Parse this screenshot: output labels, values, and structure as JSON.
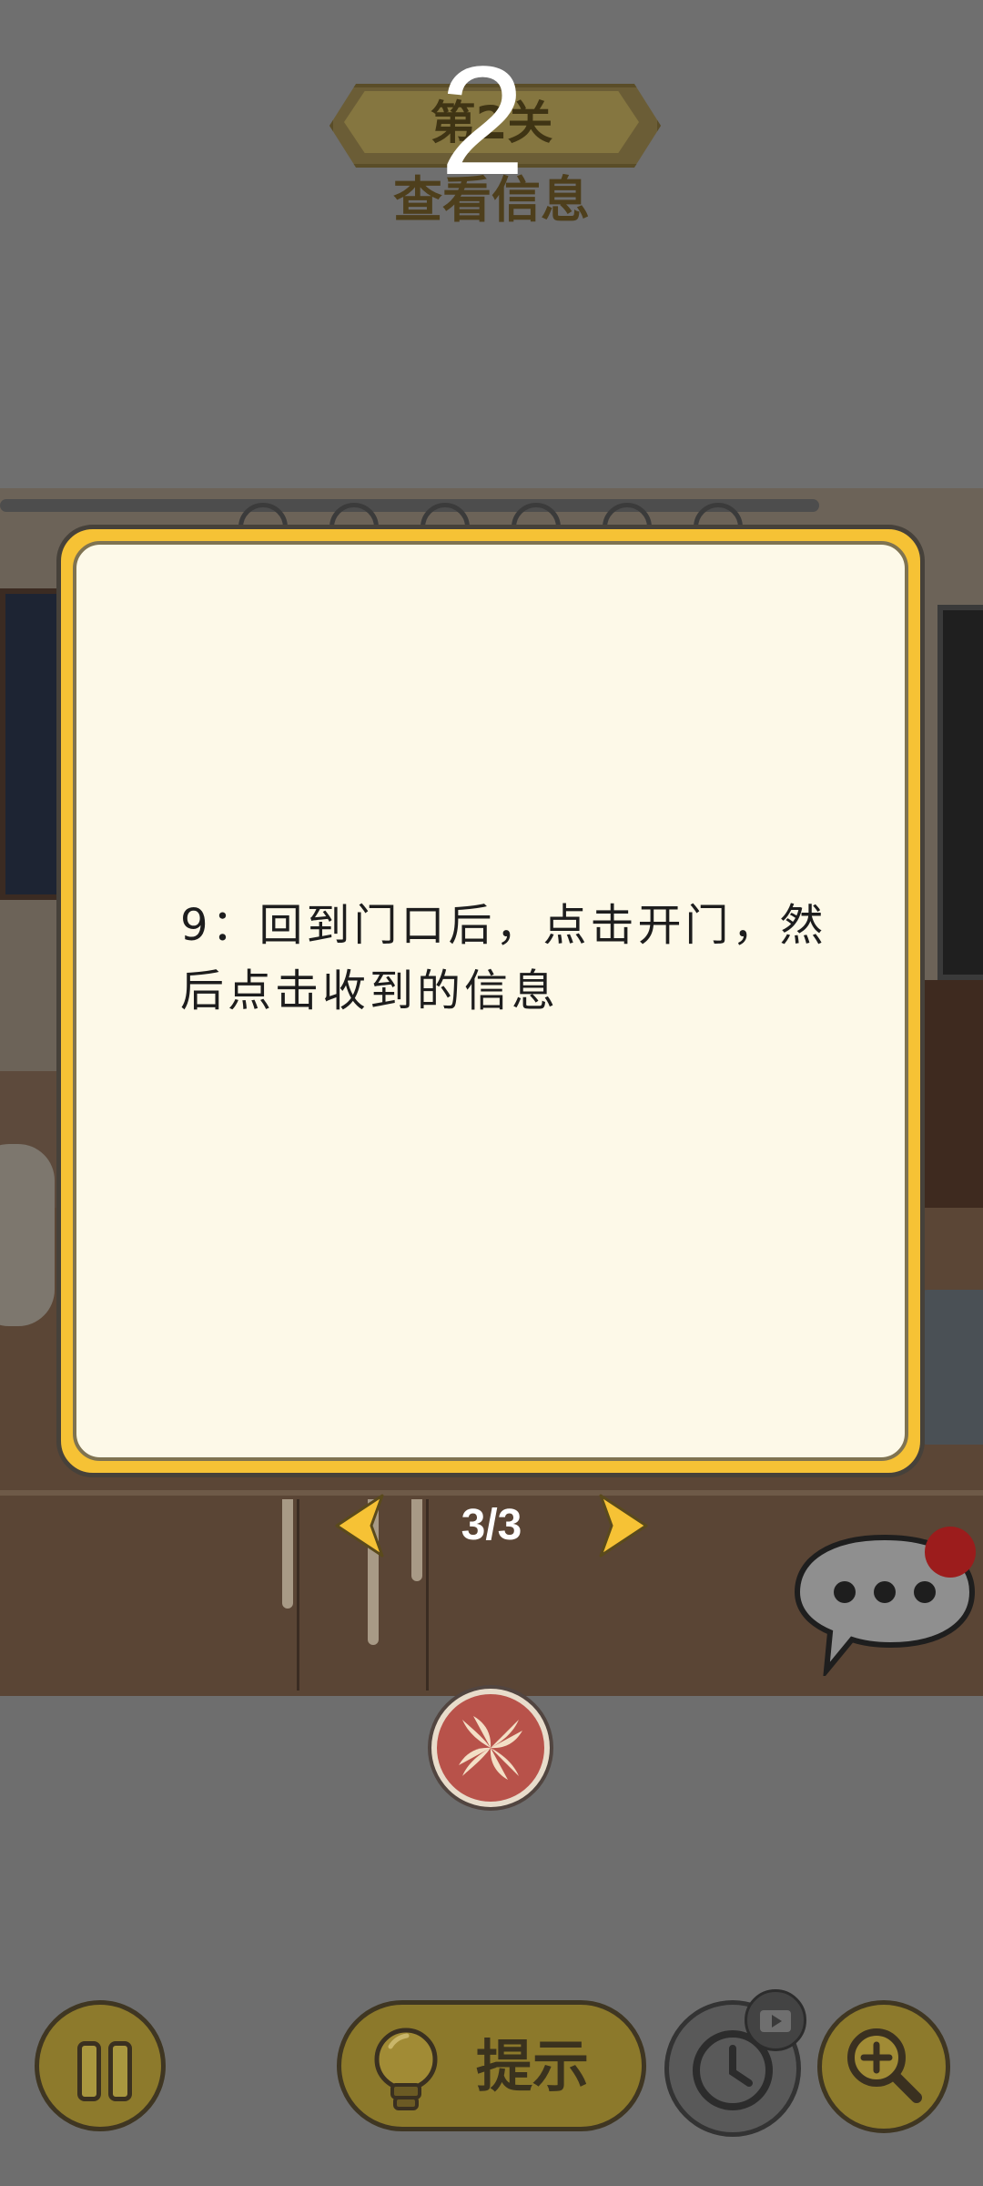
{
  "level": {
    "label": "第2关",
    "overlay_number": "2",
    "name": "查看信息"
  },
  "dialog": {
    "text": "9：回到门口后，点击开门，然后点击收到的信息"
  },
  "pager": {
    "label": "3/3",
    "current": 3,
    "total": 3
  },
  "toolbar": {
    "hint_label": "提示"
  },
  "colors": {
    "dialog_border": "#f6c235",
    "dialog_fill": "#fdf9e8",
    "arrow": "#f6c235",
    "close_button": "#b8524a",
    "toolbar_gold": "#8d7a2c"
  },
  "icons": {
    "prev": "chevron-left-icon",
    "next": "chevron-right-icon",
    "chat": "chat-bubble-icon",
    "close": "close-icon",
    "pause": "pause-icon",
    "hint": "lightbulb-icon",
    "timer": "clock-icon",
    "video": "video-icon",
    "zoom": "zoom-in-icon"
  }
}
